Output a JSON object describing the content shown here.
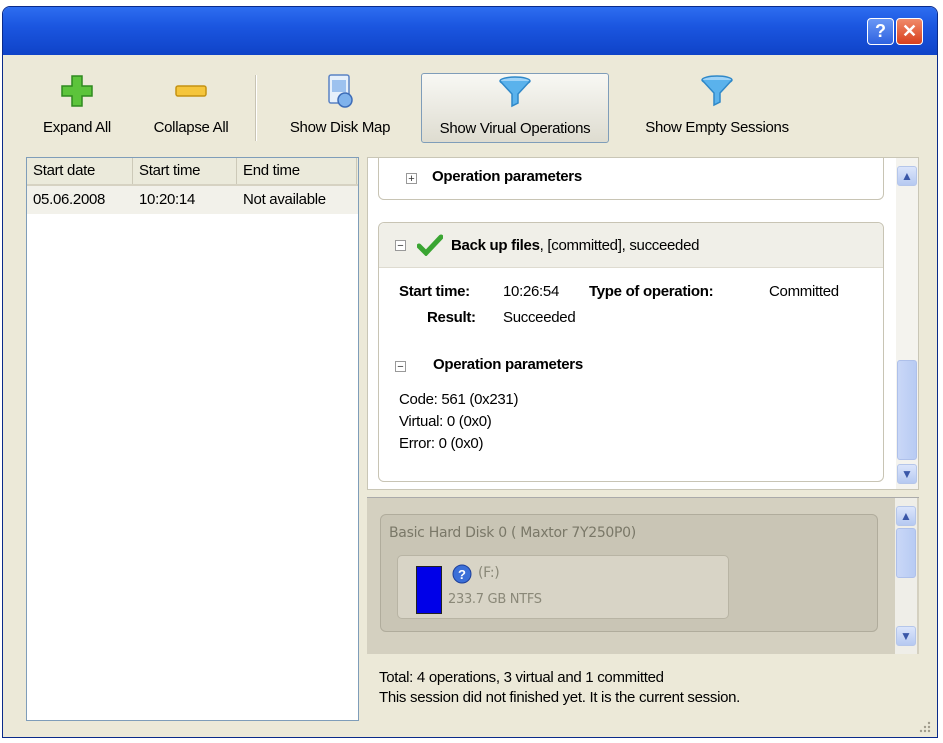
{
  "window": {
    "help_label": "?",
    "close_label": "✕"
  },
  "toolbar": {
    "expand_all": "Expand All",
    "collapse_all": "Collapse All",
    "show_disk_map": "Show Disk Map",
    "show_virtual_operations": "Show Virual Operations",
    "show_empty_sessions": "Show Empty Sessions",
    "active_tool": "show_virtual_operations"
  },
  "sessions": {
    "columns": [
      "Start date",
      "Start time",
      "End time"
    ],
    "rows": [
      {
        "start_date": "05.06.2008",
        "start_time": "10:20:14",
        "end_time": "Not available"
      }
    ]
  },
  "operations": {
    "collapsed_section_label": "Operation parameters",
    "backup": {
      "title": "Back up files",
      "status": ", [committed], succeeded",
      "start_time_label": "Start time:",
      "start_time_value": "10:26:54",
      "type_label": "Type of operation:",
      "type_value": "Committed",
      "result_label": "Result:",
      "result_value": "Succeeded",
      "params_label": "Operation parameters",
      "params": [
        "Code: 561 (0x231)",
        "Virtual: 0 (0x0)",
        "Error: 0 (0x0)"
      ]
    }
  },
  "disk_map": {
    "disk_title": "Basic Hard Disk 0 ( Maxtor 7Y250P0)",
    "partition_label": "(F:)",
    "partition_info": "233.7 GB NTFS"
  },
  "summary": {
    "line1": "Total: 4 operations, 3 virtual and 1 committed",
    "line2": "This session did not finished yet. It is the current session."
  },
  "colors": {
    "titlebar": "#1b56e0",
    "window_bg": "#ece9d8",
    "partition_bar": "#0000e8",
    "success_check": "#3aa532"
  }
}
